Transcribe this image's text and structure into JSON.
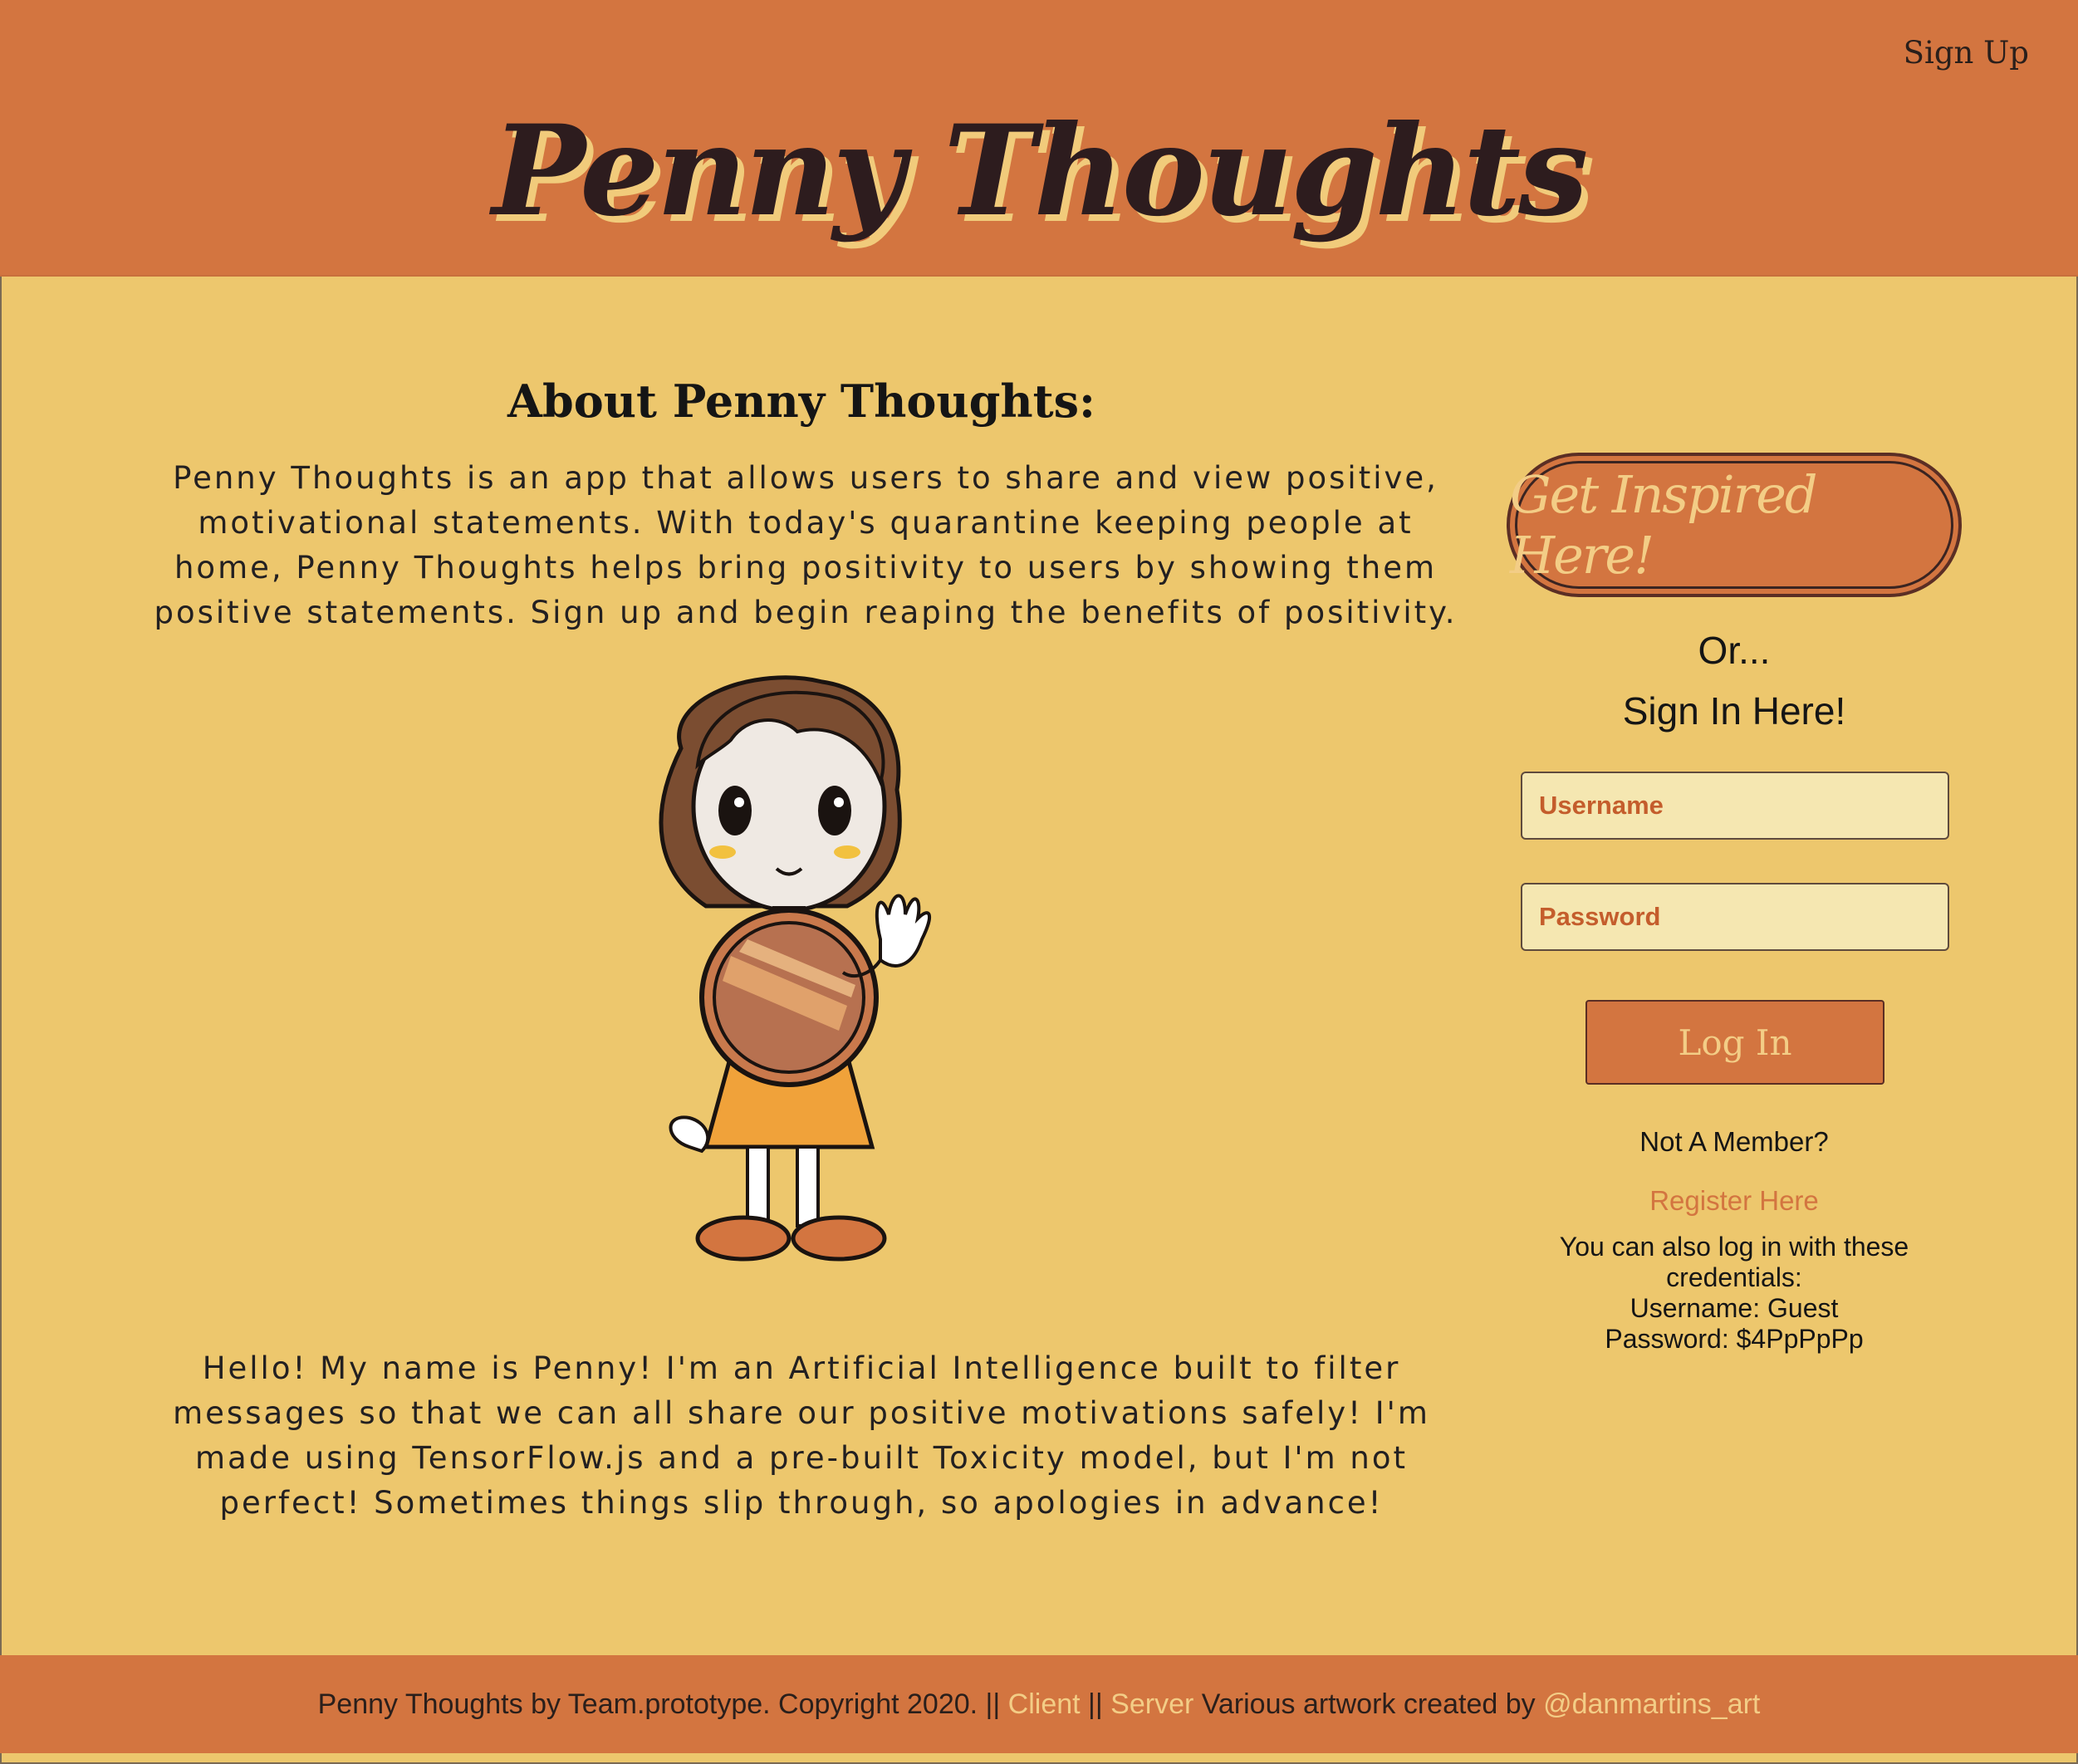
{
  "header": {
    "signup_label": "Sign Up",
    "brand": "Penny Thoughts"
  },
  "about": {
    "title": "About Penny Thoughts:",
    "text": "Penny Thoughts is an app that allows users to share and view positive, motivational statements. With today's quarantine keeping people at home, Penny Thoughts helps bring positivity to users by showing them positive statements. Sign up and begin reaping the benefits of positivity.",
    "bot_text": "Hello! My name is Penny! I'm an Artificial Intelligence built to filter messages so that we can all share our positive motivations safely! I'm made using TensorFlow.js and a pre-built Toxicity model, but I'm not perfect! Sometimes things slip through, so apologies in advance!"
  },
  "sidebar": {
    "inspire_label": "Get Inspired Here!",
    "or_text": "Or...",
    "signin_text": "Sign In Here!",
    "username_placeholder": "Username",
    "password_placeholder": "Password",
    "login_label": "Log In",
    "not_member": "Not A Member?",
    "register_label": "Register Here",
    "creds_line1": "You can also log in with these credentials:",
    "creds_line2": "Username: Guest",
    "creds_line3": "Password: $4PpPpPp"
  },
  "footer": {
    "prefix": "Penny Thoughts by Team.prototype. Copyright 2020. || ",
    "client_label": "Client",
    "sep": " || ",
    "server_label": "Server",
    "artwork_text": " Various artwork created by ",
    "artist_label": "@danmartins_art"
  },
  "colors": {
    "header_bg": "#d37540",
    "page_bg": "#edc76d",
    "accent_text": "#f3cd86",
    "field_bg": "#f5e7b1"
  }
}
